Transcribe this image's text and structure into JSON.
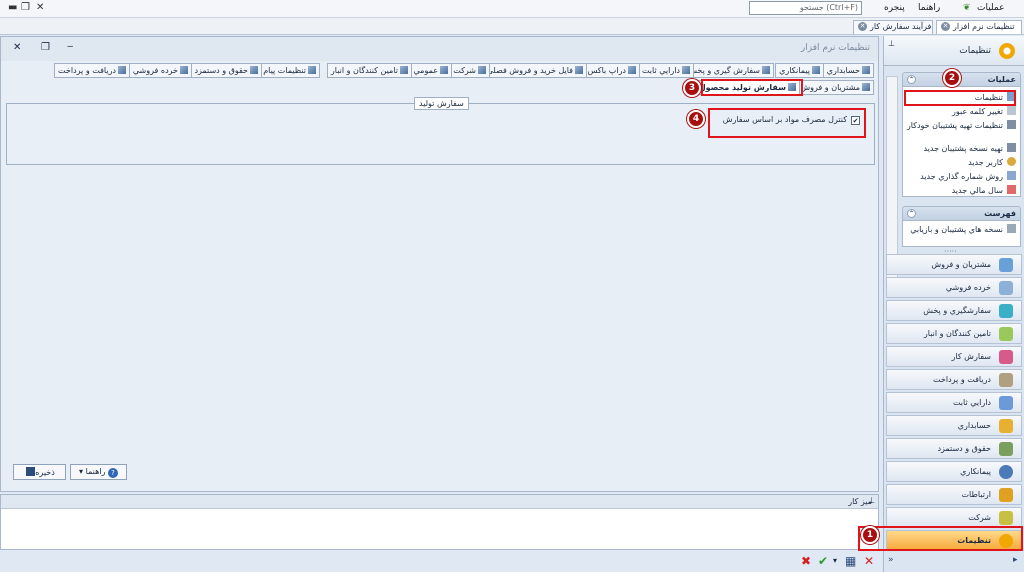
{
  "menubar": {
    "items": [
      "عمليات",
      "راهنما",
      "پنجره"
    ],
    "search": "جستجو (Ctrl+F)"
  },
  "tabs": [
    {
      "label": "فرآيند سفارش کار",
      "active": false
    },
    {
      "label": "تنظيمات نرم افزار",
      "active": true
    }
  ],
  "panel": {
    "title": "تنظيمات نرم افزار"
  },
  "settings_tabs_row1": [
    "حسابداري",
    "پيمانكاري",
    "سفارش گيري و پخش",
    "دارايي ثابت",
    "دراپ باکس",
    "فایل خرید و فروش فصلی",
    "شرکت",
    "عمومي",
    "تامين كنندگان و انبار",
    "تنظيمات پيام",
    "حقوق و دستمزد",
    "خرده فروشي",
    "دريافت و پرداخت"
  ],
  "settings_tabs_row2": [
    "مشتريان و فروش",
    "سفارش توليد محصول"
  ],
  "groupbox": {
    "title": "سفارش توليد",
    "checkbox_label": "کنترل مصرف مواد بر اساس سفارش",
    "checked": true
  },
  "buttons": {
    "save": "ذخيره",
    "help": "راهنما"
  },
  "desk": {
    "title": "ميز كار"
  },
  "nav": {
    "title": "تنظيمات",
    "tasks_header": "عمليات",
    "tasks": [
      "تنظيمات",
      "تغيير کلمه عبور",
      "تنظيمات تهيه پشتيبان خودکار",
      "تهيه نسخه پشتيبان جديد",
      "كاربر جديد",
      "روش شماره گذاري جديد",
      "سال مالي جديد"
    ],
    "list_header": "فهرست",
    "list_items": [
      "نسخه هاي پشتيبان و بازيابي"
    ],
    "categories": [
      "مشتريان و فروش",
      "خرده فروشي",
      "سفارشگيري و پخش",
      "تامين كنندگان و انبار",
      "سفارش كار",
      "دريافت و پرداخت",
      "دارايي ثابت",
      "حسابداري",
      "حقوق و دستمزد",
      "پيمانكاري",
      "ارتباطات",
      "شركت",
      "تنظيمات"
    ],
    "selected_category": "تنظيمات"
  },
  "annotations": [
    "1",
    "2",
    "3",
    "4"
  ],
  "colors": {
    "annotation_red": "#e0151b",
    "badge": "#a81010",
    "selected_category": "#f6a93a"
  }
}
